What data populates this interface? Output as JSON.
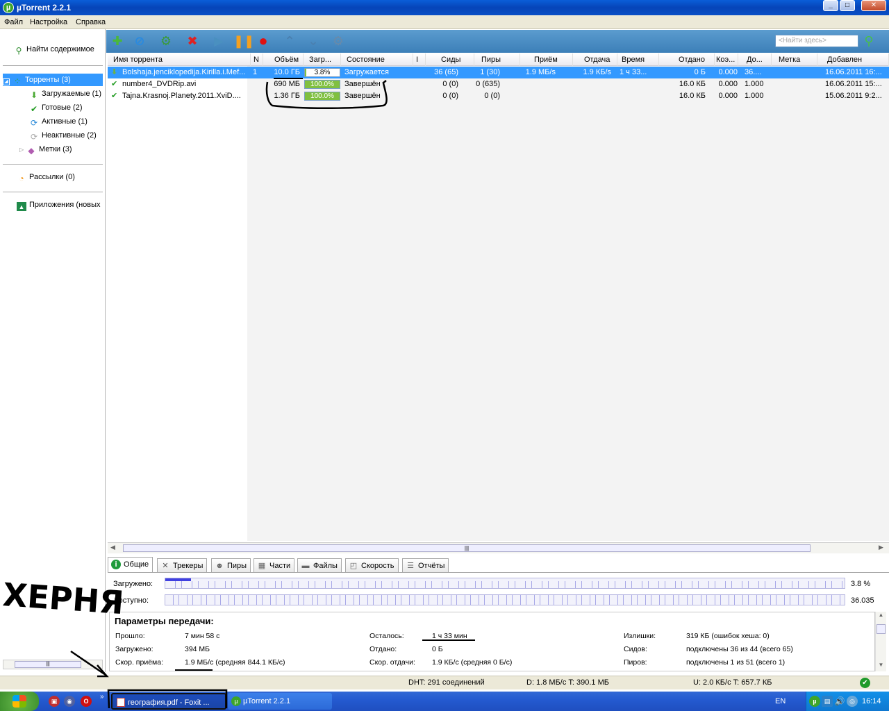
{
  "window": {
    "title": "µTorrent 2.2.1"
  },
  "menu": [
    "Файл",
    "Настройка",
    "Справка"
  ],
  "search": {
    "placeholder": "<Найти здесь>"
  },
  "sidebar": {
    "find": "Найти содержимое",
    "torrents": "Торренты (3)",
    "items": [
      "Загружаемые (1)",
      "Готовые (2)",
      "Активные (1)",
      "Неактивные (2)",
      "Метки (3)"
    ],
    "feeds": "Рассылки (0)",
    "apps": "Приложения (новых"
  },
  "columns": [
    "Имя торрента",
    "N",
    "Объём",
    "Загр...",
    "Состояние",
    "I",
    "Сиды",
    "Пиры",
    "Приём",
    "Отдача",
    "Время",
    "Отдано",
    "Коэ...",
    "До...",
    "Метка",
    "Добавлен"
  ],
  "torrents": [
    {
      "name": "Bolshaja.jenciklopedija.Kirilla.i.Mef...",
      "n": "1",
      "size": "10.0 ГБ",
      "progress": 3.8,
      "progress_label": "3.8%",
      "state": "Загружается",
      "seeds": "36 (65)",
      "peers": "1 (30)",
      "down": "1.9 МБ/s",
      "up": "1.9 КБ/s",
      "eta": "1 ч 33...",
      "uploaded": "0 Б",
      "ratio": "0.000",
      "avail": "36....",
      "label": "",
      "added": "16.06.2011 16:..."
    },
    {
      "name": "number4_DVDRip.avi",
      "n": "",
      "size": "690 МБ",
      "progress": 100,
      "progress_label": "100.0%",
      "state": "Завершён",
      "seeds": "0 (0)",
      "peers": "0 (635)",
      "down": "",
      "up": "",
      "eta": "",
      "uploaded": "16.0 КБ",
      "ratio": "0.000",
      "avail": "1.000",
      "label": "",
      "added": "16.06.2011 15:..."
    },
    {
      "name": "Tajna.Krasnoj.Planety.2011.XviD....",
      "n": "",
      "size": "1.36 ГБ",
      "progress": 100,
      "progress_label": "100.0%",
      "state": "Завершён",
      "seeds": "0 (0)",
      "peers": "0 (0)",
      "down": "",
      "up": "",
      "eta": "",
      "uploaded": "16.0 КБ",
      "ratio": "0.000",
      "avail": "1.000",
      "label": "",
      "added": "15.06.2011 9:2..."
    }
  ],
  "tabs": [
    "Общие",
    "Трекеры",
    "Пиры",
    "Части",
    "Файлы",
    "Скорость",
    "Отчёты"
  ],
  "general": {
    "downloaded_label": "Загружено:",
    "downloaded_pct": "3.8 %",
    "downloaded_fraction": 0.038,
    "available_label": "Доступно:",
    "available_value": "36.035",
    "params_title": "Параметры передачи:",
    "params": [
      {
        "label": "Прошло:",
        "value": "7 мин 58 с"
      },
      {
        "label": "Загружено:",
        "value": "394 МБ"
      },
      {
        "label": "Скор. приёма:",
        "value": "1.9 МБ/с (средняя 844.1 КБ/с)"
      },
      {
        "label": "Осталось:",
        "value": "1 ч 33 мин"
      },
      {
        "label": "Отдано:",
        "value": "0 Б"
      },
      {
        "label": "Скор. отдачи:",
        "value": "1.9 КБ/с (средняя 0 Б/с)"
      },
      {
        "label": "Излишки:",
        "value": "319 КБ (ошибок хеша: 0)"
      },
      {
        "label": "Сидов:",
        "value": "подключены 36 из 44 (всего 65)"
      },
      {
        "label": "Пиров:",
        "value": "подключены 1 из 51 (всего 1)"
      }
    ]
  },
  "status": {
    "dht": "DHT: 291 соединений",
    "down": "D: 1.8 МБ/с T: 390.1 МБ",
    "up": "U: 2.0 КБ/с T: 657.7 КБ"
  },
  "taskbar": {
    "items": [
      "география.pdf - Foxit ...",
      "µTorrent 2.2.1"
    ],
    "lang": "EN",
    "clock": "16:14"
  },
  "annotation": "ХЕРНЯ"
}
